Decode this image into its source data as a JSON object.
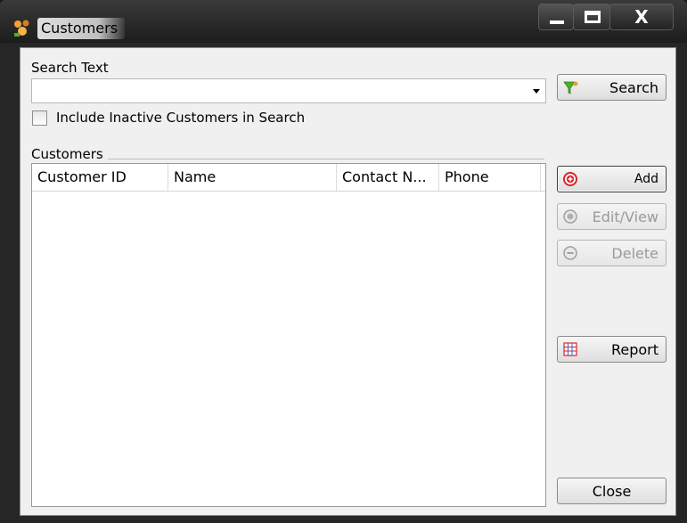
{
  "window": {
    "title": "Customers",
    "app_icon": "customers-app-icon",
    "controls": {
      "minimize": "minimize-icon",
      "maximize": "maximize-icon",
      "close": "X"
    }
  },
  "search": {
    "label": "Search Text",
    "value": "",
    "dropdown_icon": "chevron-down-icon",
    "button_label": "Search",
    "button_icon": "funnel-icon"
  },
  "include_inactive": {
    "label": "Include Inactive Customers in Search",
    "checked": false
  },
  "customers_group": {
    "label": "Customers",
    "columns": [
      "Customer ID",
      "Name",
      "Contact N...",
      "Phone"
    ],
    "rows": []
  },
  "actions": {
    "add": {
      "label": "Add",
      "icon": "add-icon",
      "enabled": true
    },
    "edit": {
      "label": "Edit/View",
      "icon": "edit-icon",
      "enabled": false
    },
    "delete": {
      "label": "Delete",
      "icon": "delete-icon",
      "enabled": false
    },
    "report": {
      "label": "Report",
      "icon": "report-grid-icon",
      "enabled": true
    },
    "close": {
      "label": "Close"
    }
  },
  "colors": {
    "add_icon": "#d9232e",
    "report_icon": "#d9232e",
    "search_icon_green": "#4caf2a"
  }
}
